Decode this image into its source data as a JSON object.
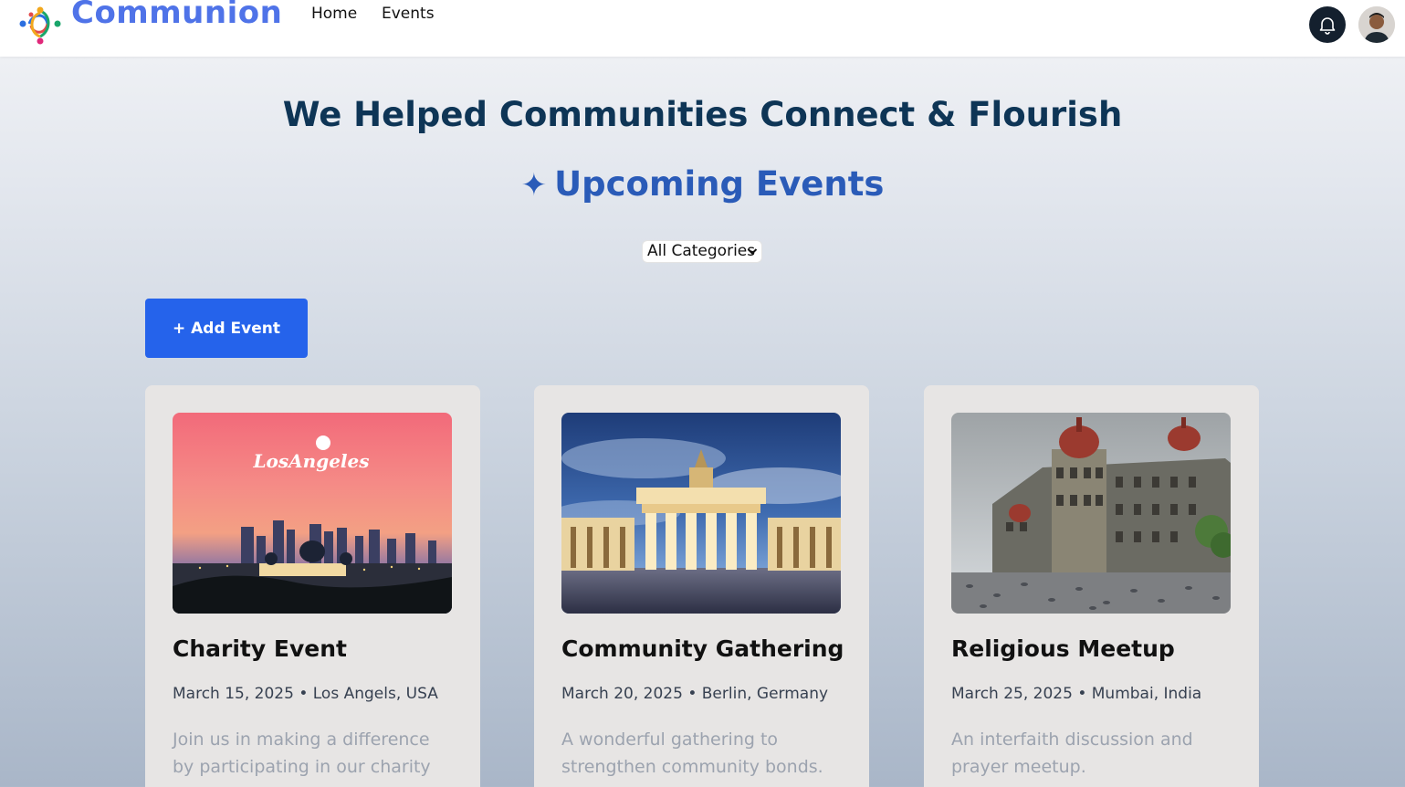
{
  "header": {
    "brand": "Communion",
    "nav": [
      {
        "label": "Home"
      },
      {
        "label": "Events"
      }
    ],
    "icons": {
      "notifications": "bell-icon",
      "profile": "avatar"
    }
  },
  "hero": {
    "title": "We Helped Communities Connect & Flourish",
    "upcoming_icon": "✦",
    "upcoming_label": "Upcoming Events"
  },
  "filter": {
    "selected": "All Categories"
  },
  "actions": {
    "add_event_label": "+ Add Event"
  },
  "events": [
    {
      "title": "Charity Event",
      "meta": "March 15, 2025 • Los Angels, USA",
      "description": "Join us in making a difference by participating in our charity event.",
      "image_text": "LosAngeles"
    },
    {
      "title": "Community Gathering",
      "meta": "March 20, 2025 • Berlin, Germany",
      "description": "A wonderful gathering to strengthen community bonds."
    },
    {
      "title": "Religious Meetup",
      "meta": "March 25, 2025 • Mumbai, India",
      "description": "An interfaith discussion and prayer meetup."
    }
  ],
  "colors": {
    "brand": "#4f73e8",
    "primary_button": "#2563eb",
    "hero_title": "#0e3556",
    "upcoming": "#2a5bb8"
  }
}
